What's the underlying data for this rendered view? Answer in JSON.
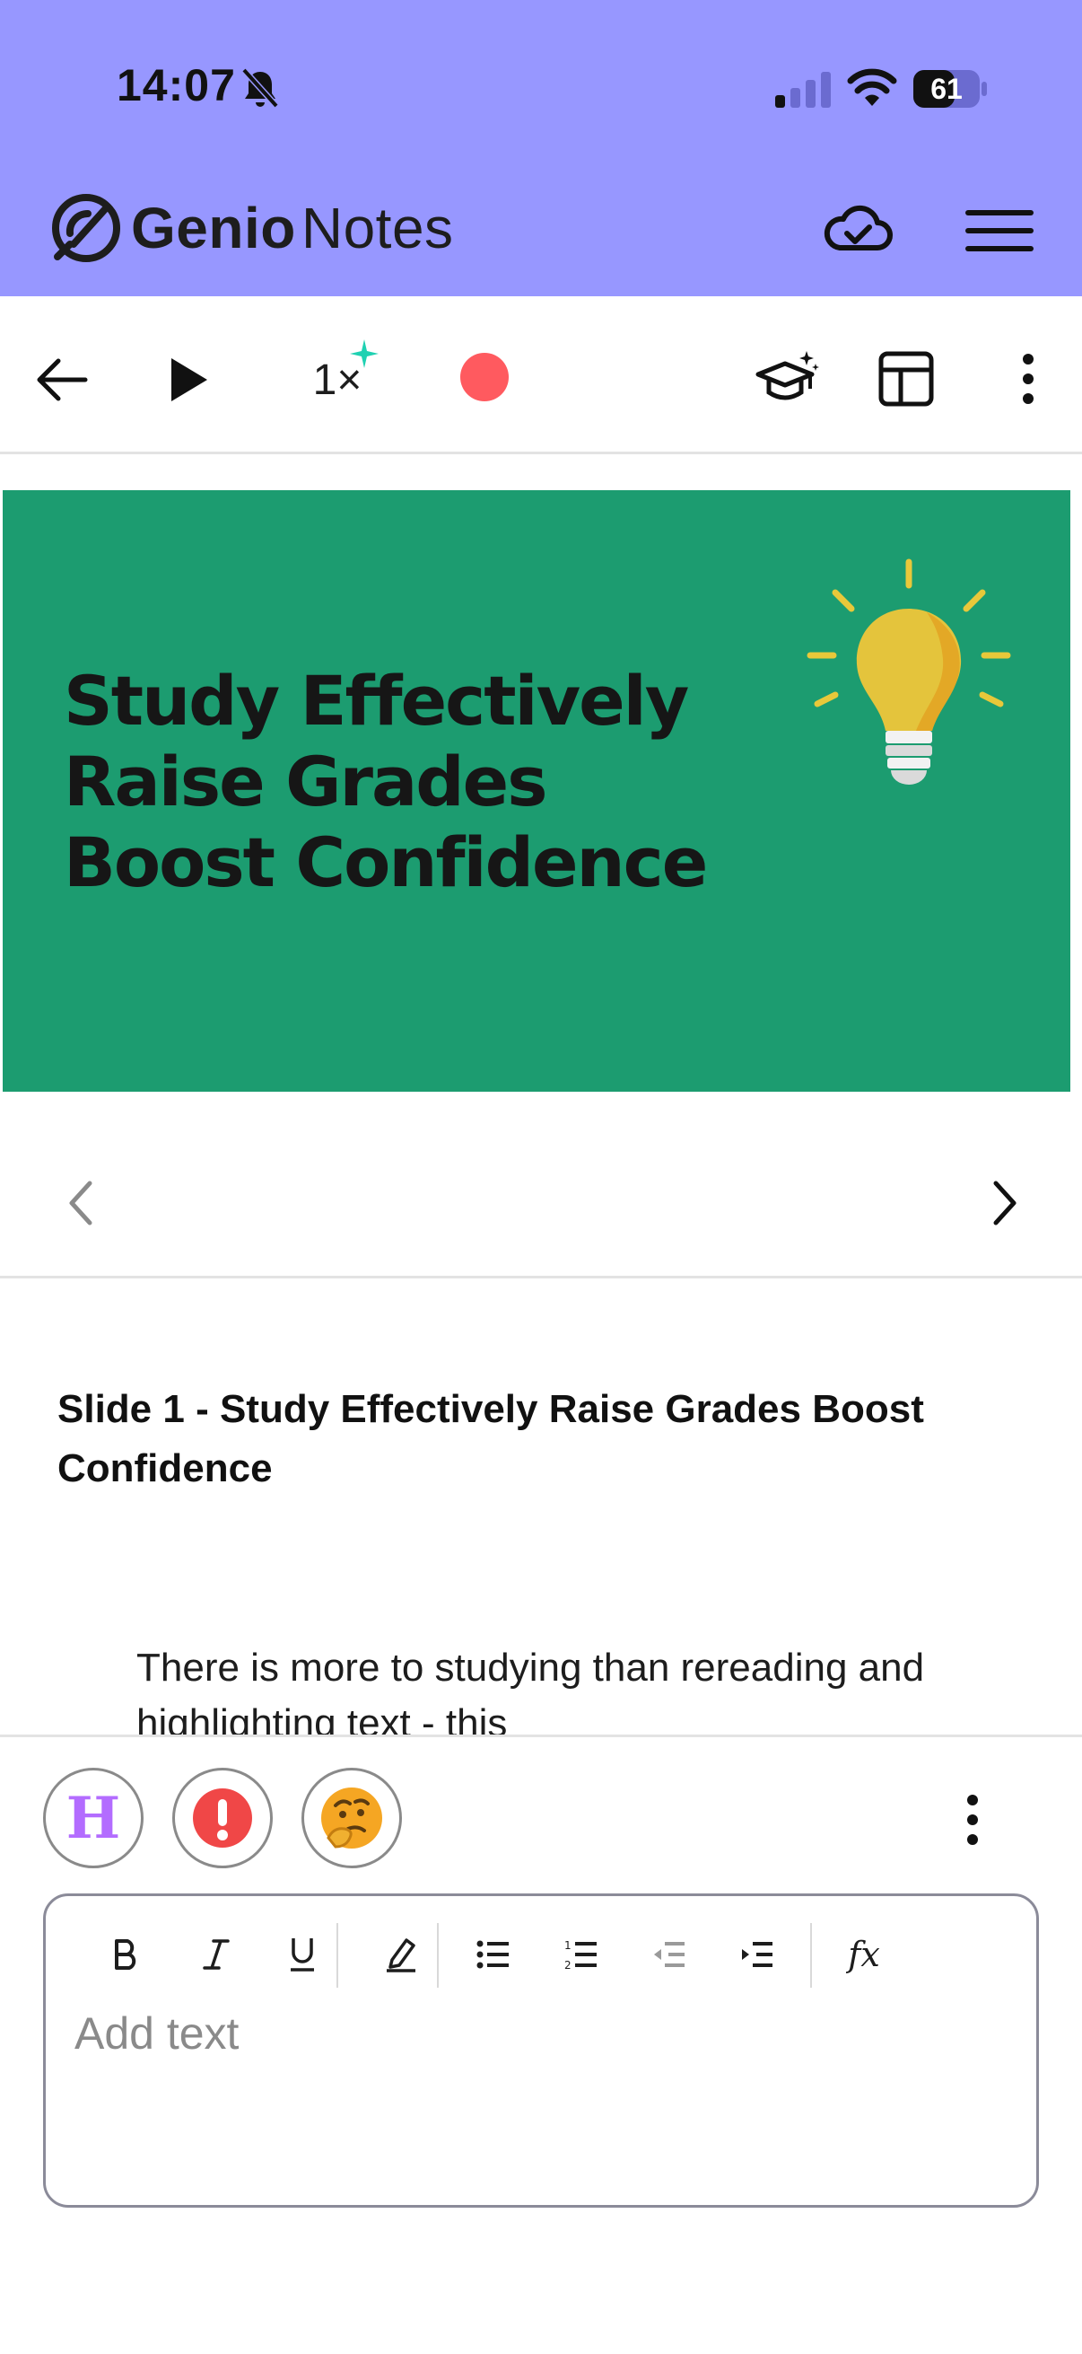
{
  "status_bar": {
    "time": "14:07",
    "battery": "61"
  },
  "app": {
    "brand_bold": "Genio",
    "brand_light": "Notes"
  },
  "toolbar": {
    "speed_label": "1×"
  },
  "slide": {
    "title_lines": [
      "Study Effectively",
      "Raise Grades",
      "Boost Confidence"
    ]
  },
  "notes": {
    "heading": "Slide 1 - Study Effectively Raise Grades Boost Confidence",
    "body": "There is more to studying than rereading and highlighting text - this"
  },
  "panel": {
    "chip_h_label": "H",
    "editor_placeholder": "Add text",
    "fx_label": "fx"
  },
  "colors": {
    "header_bg": "#9797ff",
    "slide_bg": "#1c9c70",
    "record": "#ff5a5f",
    "accent_spark": "#1fd1b2",
    "chip_h": "#b36cff"
  }
}
